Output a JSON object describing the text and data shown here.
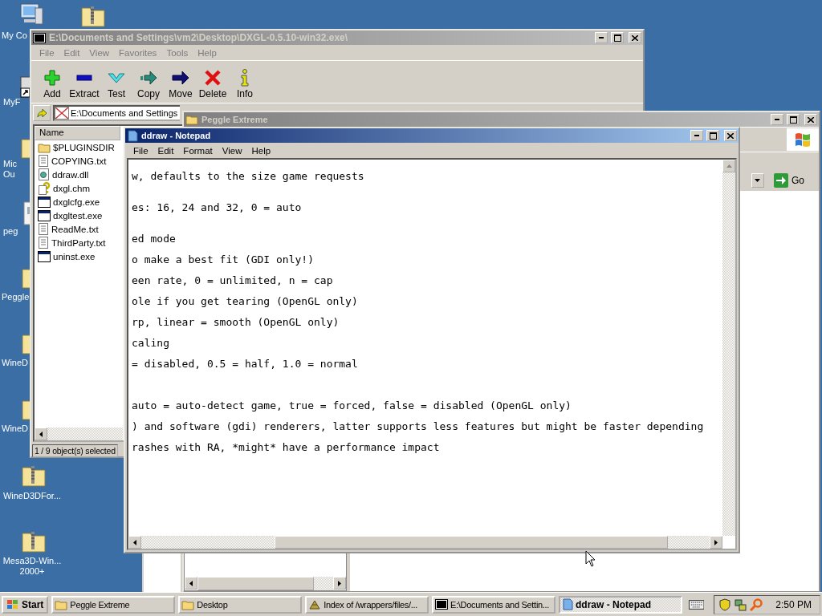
{
  "desktop_icons": [
    {
      "kind": "computer",
      "lines": [
        "My Co"
      ]
    },
    {
      "kind": "zip-folder"
    },
    {
      "kind": "shortcut",
      "lines": [
        "MyF"
      ]
    },
    {
      "kind": "zip-folder",
      "lines": [
        "Mic",
        "Ou"
      ]
    },
    {
      "kind": "document",
      "lines": [
        "peg"
      ]
    },
    {
      "kind": "folder",
      "lines": [
        "Peggle"
      ]
    },
    {
      "kind": "zip-folder",
      "lines": [
        "WineD"
      ]
    },
    {
      "kind": "zip-folder",
      "lines": [
        "WineD"
      ]
    },
    {
      "kind": "zip-folder",
      "lines": [
        "WineD3DFor..."
      ]
    },
    {
      "kind": "zip-folder",
      "lines": [
        "Mesa3D-Win...",
        "2000+"
      ]
    }
  ],
  "archive_window": {
    "title": "E:\\Documents and Settings\\vm2\\Desktop\\DXGL-0.5.10-win32.exe\\",
    "menu": [
      "File",
      "Edit",
      "View",
      "Favorites",
      "Tools",
      "Help"
    ],
    "toolbar": [
      {
        "kind": "add",
        "label": "Add"
      },
      {
        "kind": "extract",
        "label": "Extract"
      },
      {
        "kind": "test",
        "label": "Test"
      },
      {
        "kind": "copy",
        "label": "Copy"
      },
      {
        "kind": "move",
        "label": "Move"
      },
      {
        "kind": "delete",
        "label": "Delete"
      },
      {
        "kind": "info",
        "label": "Info"
      }
    ],
    "address": "E:\\Documents and Settings",
    "column": "Name",
    "files": [
      {
        "kind": "folder",
        "name": "$PLUGINSDIR"
      },
      {
        "kind": "text",
        "name": "COPYING.txt"
      },
      {
        "kind": "dll",
        "name": "ddraw.dll"
      },
      {
        "kind": "help",
        "name": "dxgl.chm"
      },
      {
        "kind": "exe",
        "name": "dxglcfg.exe"
      },
      {
        "kind": "exe",
        "name": "dxgltest.exe"
      },
      {
        "kind": "text",
        "name": "ReadMe.txt"
      },
      {
        "kind": "text",
        "name": "ThirdParty.txt"
      },
      {
        "kind": "exe",
        "name": "uninst.exe"
      }
    ],
    "status": "1 / 9 object(s) selected"
  },
  "explorer_window": {
    "title": "Peggle Extreme",
    "go_button": "Go"
  },
  "notepad": {
    "title": "ddraw - Notepad",
    "active": true,
    "menu": [
      "File",
      "Edit",
      "Format",
      "View",
      "Help"
    ],
    "lines": [
      {
        "kind": "text",
        "text": "w, defaults to the size game requests"
      },
      {
        "kind": "blank"
      },
      {
        "kind": "text",
        "text": "es: 16, 24 and 32, 0 = auto"
      },
      {
        "kind": "blank"
      },
      {
        "kind": "text",
        "text": "ed mode"
      },
      {
        "kind": "text",
        "text": "o make a best fit (GDI only!)"
      },
      {
        "kind": "text",
        "text": "een rate, 0 = unlimited, n = cap"
      },
      {
        "kind": "text",
        "text": "ole if you get tearing (OpenGL only)"
      },
      {
        "kind": "text",
        "text": "rp, linear = smooth (OpenGL only)"
      },
      {
        "kind": "text",
        "text": "caling"
      },
      {
        "kind": "text",
        "text": "= disabled, 0.5 = half, 1.0 = normal"
      },
      {
        "kind": "blank"
      },
      {
        "kind": "blank"
      },
      {
        "kind": "text",
        "text": "auto = auto-detect game, true = forced, false = disabled (OpenGL only)"
      },
      {
        "kind": "text",
        "text": ") and software (gdi) renderers, latter supports less features but might be faster depending"
      },
      {
        "kind": "text",
        "text": "rashes with RA, *might* have a performance impact"
      }
    ]
  },
  "taskbar": {
    "start": "Start",
    "tasks": [
      {
        "kind": "folder",
        "label": "Peggle Extreme",
        "selected": false
      },
      {
        "kind": "folder",
        "label": "Desktop",
        "selected": false
      },
      {
        "kind": "browser",
        "label": "Index of /wrappers/files/...",
        "selected": false
      },
      {
        "kind": "archive",
        "label": "E:\\Documents and Settin...",
        "selected": false
      },
      {
        "kind": "notepad",
        "label": "ddraw - Notepad",
        "selected": true
      }
    ],
    "clock": "2:50 PM"
  }
}
